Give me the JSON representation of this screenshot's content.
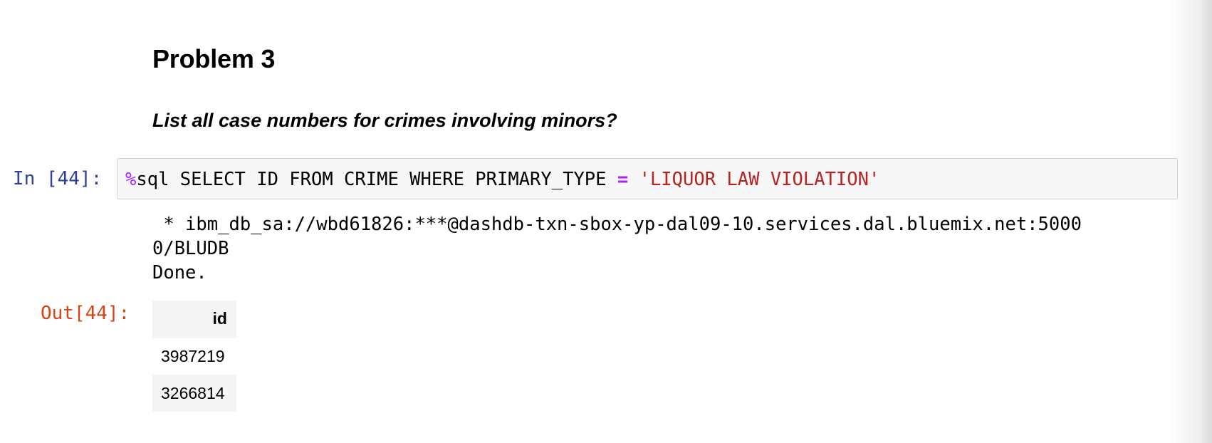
{
  "markdown": {
    "heading": "Problem 3",
    "question": "List all case numbers for crimes involving minors?"
  },
  "input_cell": {
    "prompt": "In [44]:",
    "code": {
      "magic": "%",
      "part1": "sql SELECT ID FROM CRIME WHERE PRIMARY_TYPE ",
      "operator": "=",
      "part2": " ",
      "string_literal": "'LIQUOR LAW VIOLATION'"
    }
  },
  "stdout": {
    "line1": " * ibm_db_sa://wbd61826:***@dashdb-txn-sbox-yp-dal09-10.services.dal.bluemix.net:5000",
    "line2": "0/BLUDB",
    "line3": "Done."
  },
  "output_cell": {
    "prompt": "Out[44]:",
    "table": {
      "columns": [
        "id"
      ],
      "rows": [
        [
          "3987219"
        ],
        [
          "3266814"
        ]
      ]
    }
  },
  "colors": {
    "in_prompt": "#303f9f",
    "out_prompt": "#d84315",
    "magic": "#aa22ff",
    "string": "#ba2121"
  }
}
